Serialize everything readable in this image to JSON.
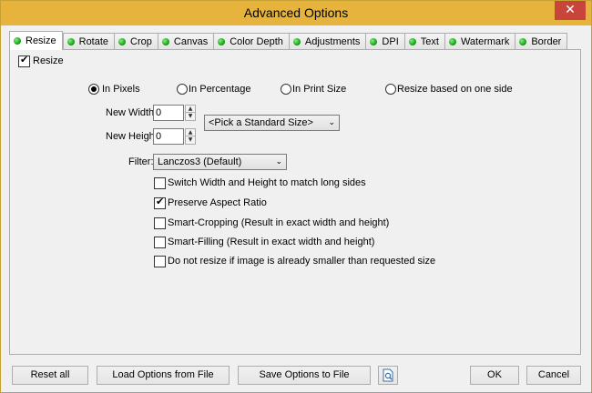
{
  "window": {
    "title": "Advanced Options",
    "close_glyph": "✕"
  },
  "tabs": [
    {
      "label": "Resize",
      "active": true
    },
    {
      "label": "Rotate"
    },
    {
      "label": "Crop"
    },
    {
      "label": "Canvas"
    },
    {
      "label": "Color Depth"
    },
    {
      "label": "Adjustments"
    },
    {
      "label": "DPI"
    },
    {
      "label": "Text"
    },
    {
      "label": "Watermark"
    },
    {
      "label": "Border"
    }
  ],
  "resize": {
    "enable_label": "Resize",
    "enable_checked": true,
    "modes": [
      {
        "label": "In Pixels",
        "selected": true
      },
      {
        "label": "In Percentage",
        "selected": false
      },
      {
        "label": "In Print Size",
        "selected": false
      },
      {
        "label": "Resize based on one side",
        "selected": false
      }
    ],
    "width_label": "New Width:",
    "width_value": "0",
    "height_label": "New Height:",
    "height_value": "0",
    "standard_size": "<Pick a Standard Size>",
    "filter_label": "Filter:",
    "filter_value": "Lanczos3 (Default)",
    "options": [
      {
        "label": "Switch Width and Height to match long sides",
        "checked": false
      },
      {
        "label": "Preserve Aspect Ratio",
        "checked": true
      },
      {
        "label": "Smart-Cropping (Result in exact width and height)",
        "checked": false
      },
      {
        "label": "Smart-Filling (Result in exact width and height)",
        "checked": false
      },
      {
        "label": "Do not resize if image is already smaller than requested size",
        "checked": false
      }
    ]
  },
  "footer": {
    "reset": "Reset all",
    "load": "Load Options from File",
    "save": "Save Options to File",
    "ok": "OK",
    "cancel": "Cancel"
  },
  "colors": {
    "titlebar": "#e6b43c",
    "close": "#c7453b",
    "tab_dot": "#0a9a0a"
  }
}
